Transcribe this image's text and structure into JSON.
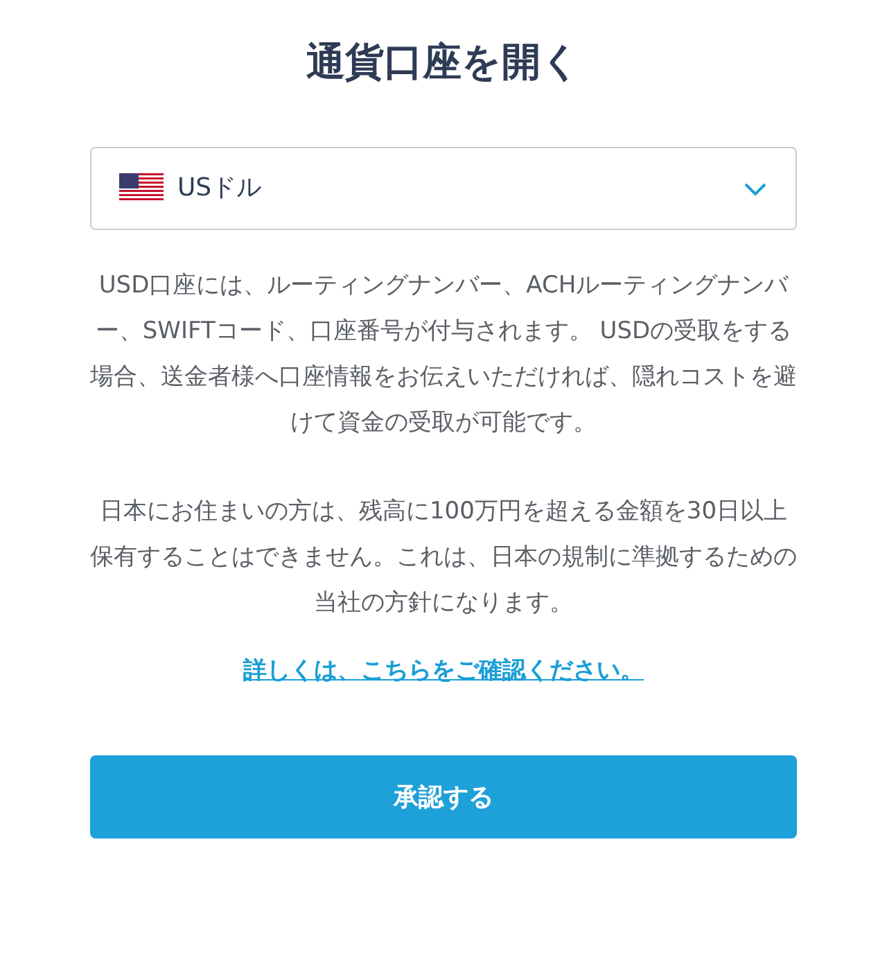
{
  "title": "通貨口座を開く",
  "currency_select": {
    "value": "USドル"
  },
  "paragraphs": [
    "USD口座には、ルーティングナンバー、ACHルーティングナンバー、SWIFTコード、口座番号が付与されます。 USDの受取をする場合、送金者様へ口座情報をお伝えいただければ、隠れコストを避けて資金の受取が可能です。",
    "日本にお住まいの方は、残高に100万円を超える金額を30日以上保有することはできません。これは、日本の規制に準拠するための当社の方針になります。"
  ],
  "link": "詳しくは、こちらをご確認ください。",
  "button": "承認する"
}
